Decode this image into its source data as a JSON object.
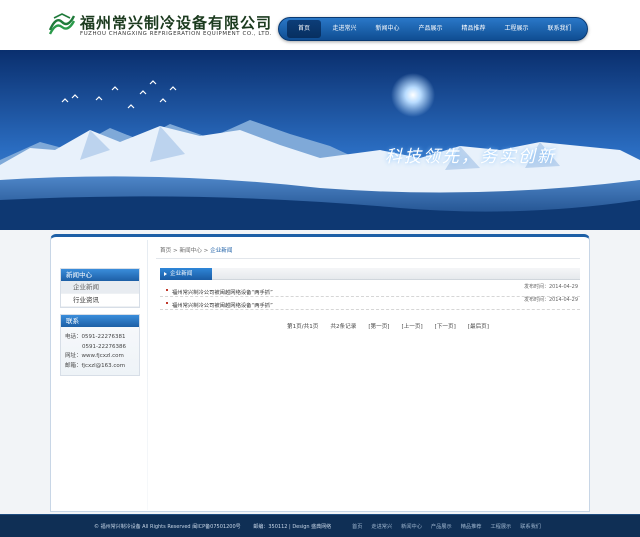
{
  "logo": {
    "company_cn": "福州常兴制冷设备有限公司",
    "company_en": "FUZHOU CHANGXING REFRIGERATION EQUIPMENT CO., LTD."
  },
  "nav": {
    "items": [
      "首页",
      "走进常兴",
      "新闻中心",
      "产品展示",
      "精品推荐",
      "工程展示",
      "联系我们"
    ]
  },
  "banner": {
    "slogan": "科技领先，务实创新"
  },
  "sidebar": {
    "news_title": "新闻中心",
    "news_items": [
      "企业新闻",
      "行业资讯"
    ],
    "contact_title": "联系",
    "contact": {
      "phone_label": "电话：",
      "phone1": "0591-22276381",
      "phone2": "0591-22276386",
      "website": "网址：www.fjcxzl.com",
      "email": "邮箱：fjcxzl@163.com"
    }
  },
  "breadcrumb": {
    "home": "首页",
    "sep": " > ",
    "section": "新闻中心",
    "current": "企业新闻"
  },
  "section": {
    "title": "企业新闻"
  },
  "news": [
    {
      "title": "福州常兴制冷公司被闽越网络设备“两手抓”",
      "date": "发布时间：2014-04-29"
    },
    {
      "title": "福州常兴制冷公司被闽越网络设备“两手抓”",
      "date": "发布时间：2014-04-29"
    }
  ],
  "pager": {
    "page_info": "第1页/共1页",
    "record_info": "共2条记录",
    "first": "[第一页]",
    "prev": "[上一页]",
    "next": "[下一页]",
    "last": "[最后页]"
  },
  "footer": {
    "copyright": "© 福州常兴制冷设备 All Rights Reserved 闽ICP备07501200号",
    "postcode": "邮编：350112",
    "design": "Design 盛典网络",
    "nav": [
      "首页",
      "走进常兴",
      "新闻中心",
      "产品展示",
      "精品推荐",
      "工程展示",
      "联系我们"
    ]
  },
  "colors": {
    "accent": "#1d5fa6",
    "nav_bg": "#0f4d92",
    "footer_bg": "#0f2f55"
  }
}
